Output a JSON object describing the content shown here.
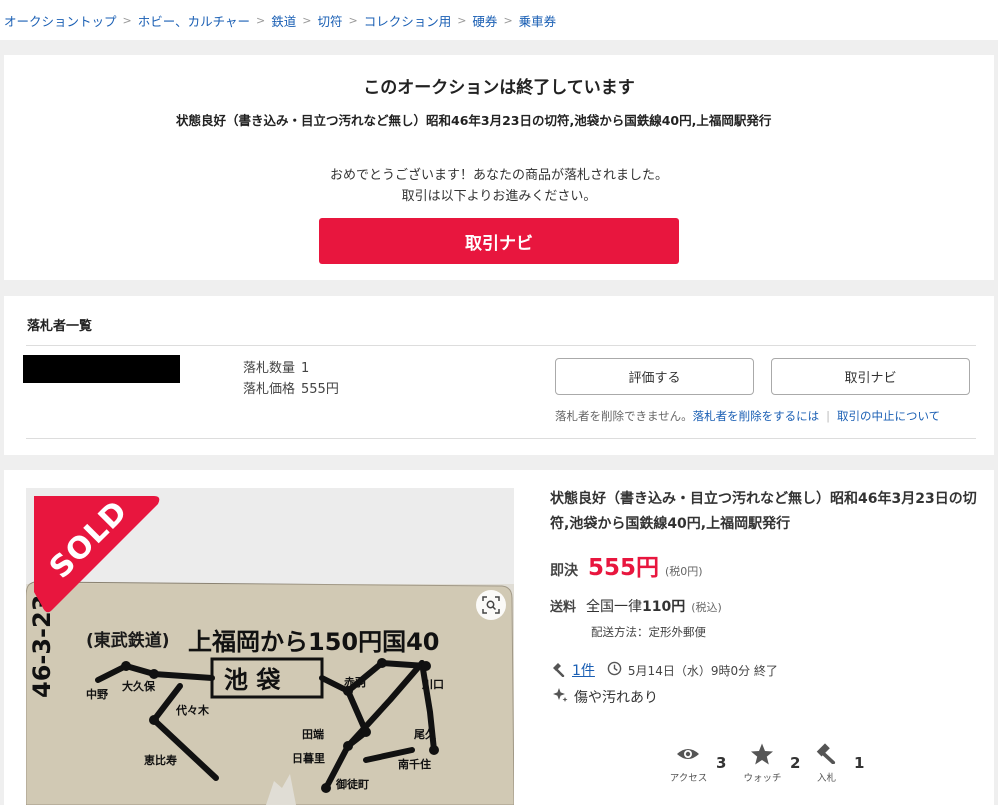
{
  "breadcrumb": [
    "オークショントップ",
    "ホビー、カルチャー",
    "鉄道",
    "切符",
    "コレクション用",
    "硬券",
    "乗車券"
  ],
  "ended": {
    "title": "このオークションは終了しています",
    "item_title": "状態良好（書き込み・目立つ汚れなど無し）昭和46年3月23日の切符,池袋から国鉄線40円,上福岡駅発行",
    "message_line1": "おめでとうございます！あなたの商品が落札されました。",
    "message_line2": "取引は以下よりお進みください。",
    "button": "取引ナビ"
  },
  "winners": {
    "title": "落札者一覧",
    "quantity_label": "落札数量",
    "quantity": "1",
    "price_label": "落札価格",
    "price": "555円",
    "rate_button": "評価する",
    "navi_button": "取引ナビ",
    "note": "落札者を削除できません。",
    "delete_link": "落札者を削除をするには",
    "cancel_link": "取引の中止について"
  },
  "item": {
    "sold_badge": "SOLD",
    "title": "状態良好（書き込み・目立つ汚れなど無し）昭和46年3月23日の切符,池袋から国鉄線40円,上福岡駅発行",
    "price_label": "即決",
    "price": "555円",
    "price_tax": "(税0円)",
    "shipping_label": "送料",
    "shipping_area": "全国一律",
    "shipping_price": "110円",
    "shipping_tax": "(税込)",
    "shipping_method": "配送方法：定形外郵便",
    "bids": "1件",
    "end_time": "5月14日（水）9時0分 終了",
    "condition": "傷や汚れあり",
    "stats": [
      {
        "label": "アクセス",
        "value": "3",
        "icon": "eye-icon"
      },
      {
        "label": "ウォッチ",
        "value": "2",
        "icon": "star-icon"
      },
      {
        "label": "入札",
        "value": "1",
        "icon": "gavel-icon"
      }
    ],
    "ticket": {
      "company": "(東武鉄道)",
      "route": "上福岡から150円国40",
      "station": "池 袋",
      "date": "46-3-23",
      "stations_left": [
        "中野",
        "大久保",
        "代々木",
        "恵比寿"
      ],
      "stations_right": [
        "赤羽",
        "川口",
        "田端",
        "日暮里",
        "尾久",
        "南千住",
        "御徒町"
      ]
    },
    "colors": {
      "accent": "#e8163e",
      "link": "#1a5fb4"
    }
  }
}
